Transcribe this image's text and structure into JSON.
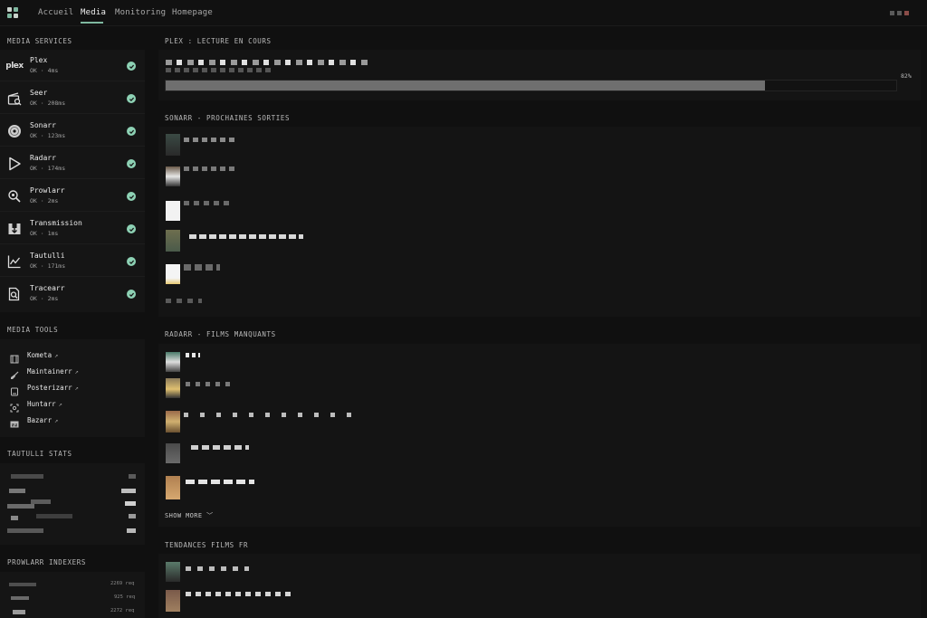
{
  "nav": {
    "tabs": [
      {
        "label": "Accueil",
        "active": false
      },
      {
        "label": "Media",
        "active": true
      },
      {
        "label": "Monitoring",
        "active": false
      },
      {
        "label": "Homepage",
        "active": false
      }
    ]
  },
  "sidebar": {
    "media_services_title": "MEDIA SERVICES",
    "services": [
      {
        "name": "Plex",
        "status": "OK · 4ms",
        "icon": "plex-logo-icon"
      },
      {
        "name": "Seer",
        "status": "OK · 208ms",
        "icon": "clapperboard-search-icon"
      },
      {
        "name": "Sonarr",
        "status": "OK · 123ms",
        "icon": "disc-icon"
      },
      {
        "name": "Radarr",
        "status": "OK · 174ms",
        "icon": "play-icon"
      },
      {
        "name": "Prowlarr",
        "status": "OK · 2ms",
        "icon": "search-icon"
      },
      {
        "name": "Transmission",
        "status": "OK · 1ms",
        "icon": "download-box-icon"
      },
      {
        "name": "Tautulli",
        "status": "OK · 171ms",
        "icon": "chart-line-icon"
      },
      {
        "name": "Tracearr",
        "status": "OK · 2ms",
        "icon": "file-search-icon"
      }
    ],
    "media_tools_title": "MEDIA TOOLS",
    "tools": [
      {
        "name": "Kometa",
        "ext": "↗",
        "icon": "film-icon"
      },
      {
        "name": "Maintainerr",
        "ext": "↗",
        "icon": "broom-icon"
      },
      {
        "name": "Posterizarr",
        "ext": "↗",
        "icon": "frame-icon"
      },
      {
        "name": "Huntarr",
        "ext": "↗",
        "icon": "target-icon"
      },
      {
        "name": "Bazarr",
        "ext": "↗",
        "icon": "subtitles-icon"
      }
    ],
    "tautulli_title": "TAUTULLI STATS",
    "prowlarr_title": "PROWLARR INDEXERS",
    "prowlarr_reqs": [
      "2269 req",
      "925 req",
      "2272 req"
    ]
  },
  "main": {
    "plex_title": "PLEX : LECTURE EN COURS",
    "plex_progress_pct": 82,
    "plex_progress_label": "82%",
    "sonarr_title": "SONARR - PROCHAINES SORTIES",
    "radarr_title": "RADARR - FILMS MANQUANTS",
    "show_more": "SHOW MORE ﹀",
    "tendances_title": "TENDANCES FILMS FR"
  },
  "colors": {
    "accent": "#7fb8a0",
    "ok": "#8dd1b4",
    "background": "#101010",
    "card": "#151515"
  }
}
